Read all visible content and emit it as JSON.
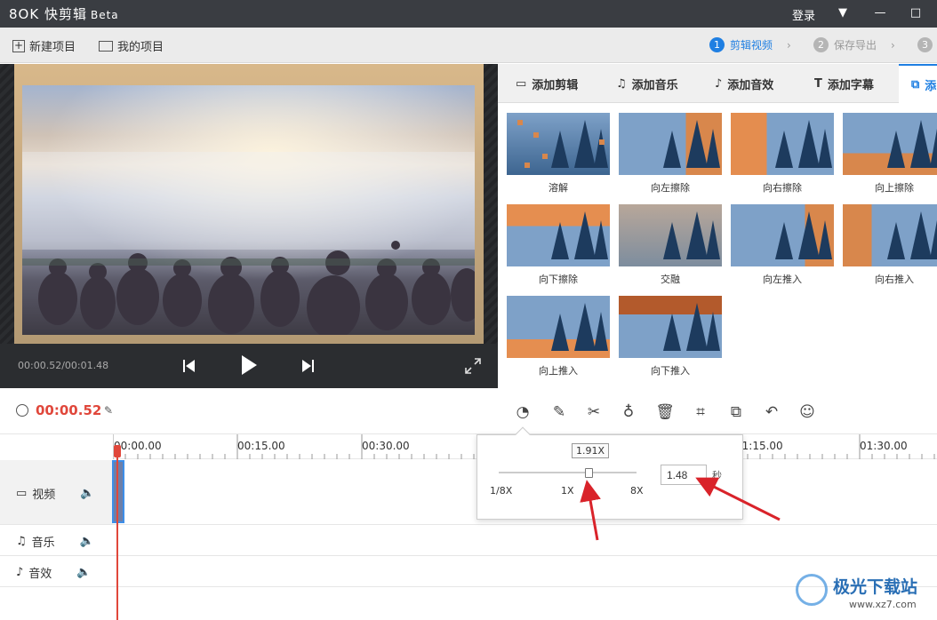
{
  "app": {
    "logo": "8OK 快剪辑",
    "beta": "Beta"
  },
  "titlebar": {
    "login": "登录"
  },
  "menubar": {
    "new_project": "新建项目",
    "my_projects": "我的项目",
    "steps": [
      {
        "num": "1",
        "label": "剪辑视频"
      },
      {
        "num": "2",
        "label": "保存导出"
      },
      {
        "num": "3",
        "label": ""
      }
    ]
  },
  "player": {
    "timecode": "00:00.52/00:01.48"
  },
  "panel": {
    "tabs": [
      "添加剪辑",
      "添加音乐",
      "添加音效",
      "添加字幕",
      "添"
    ],
    "transitions": [
      "溶解",
      "向左擦除",
      "向右擦除",
      "向上擦除",
      "向下擦除",
      "交融",
      "向左推入",
      "向右推入",
      "向上推入",
      "向下推入"
    ]
  },
  "toolbar": {
    "current_time": "00:00.52"
  },
  "timeline": {
    "ruler": [
      "00:00.00",
      "00:15.00",
      "00:30.00",
      "01:15.00",
      "01:30.00"
    ],
    "tracks": [
      "视频",
      "音乐",
      "音效"
    ]
  },
  "speed_popup": {
    "value_tip": "1.91X",
    "labels": [
      "1/8X",
      "1X",
      "8X"
    ],
    "duration_value": "1.48",
    "unit": "秒",
    "slider_level": 0.65
  },
  "watermark": {
    "brand": "极光下载站",
    "url": "www.xz7.com"
  },
  "colors": {
    "accent": "#1f7fe2",
    "timecode_red": "#e0473b",
    "arrow_red": "#d9232a"
  }
}
